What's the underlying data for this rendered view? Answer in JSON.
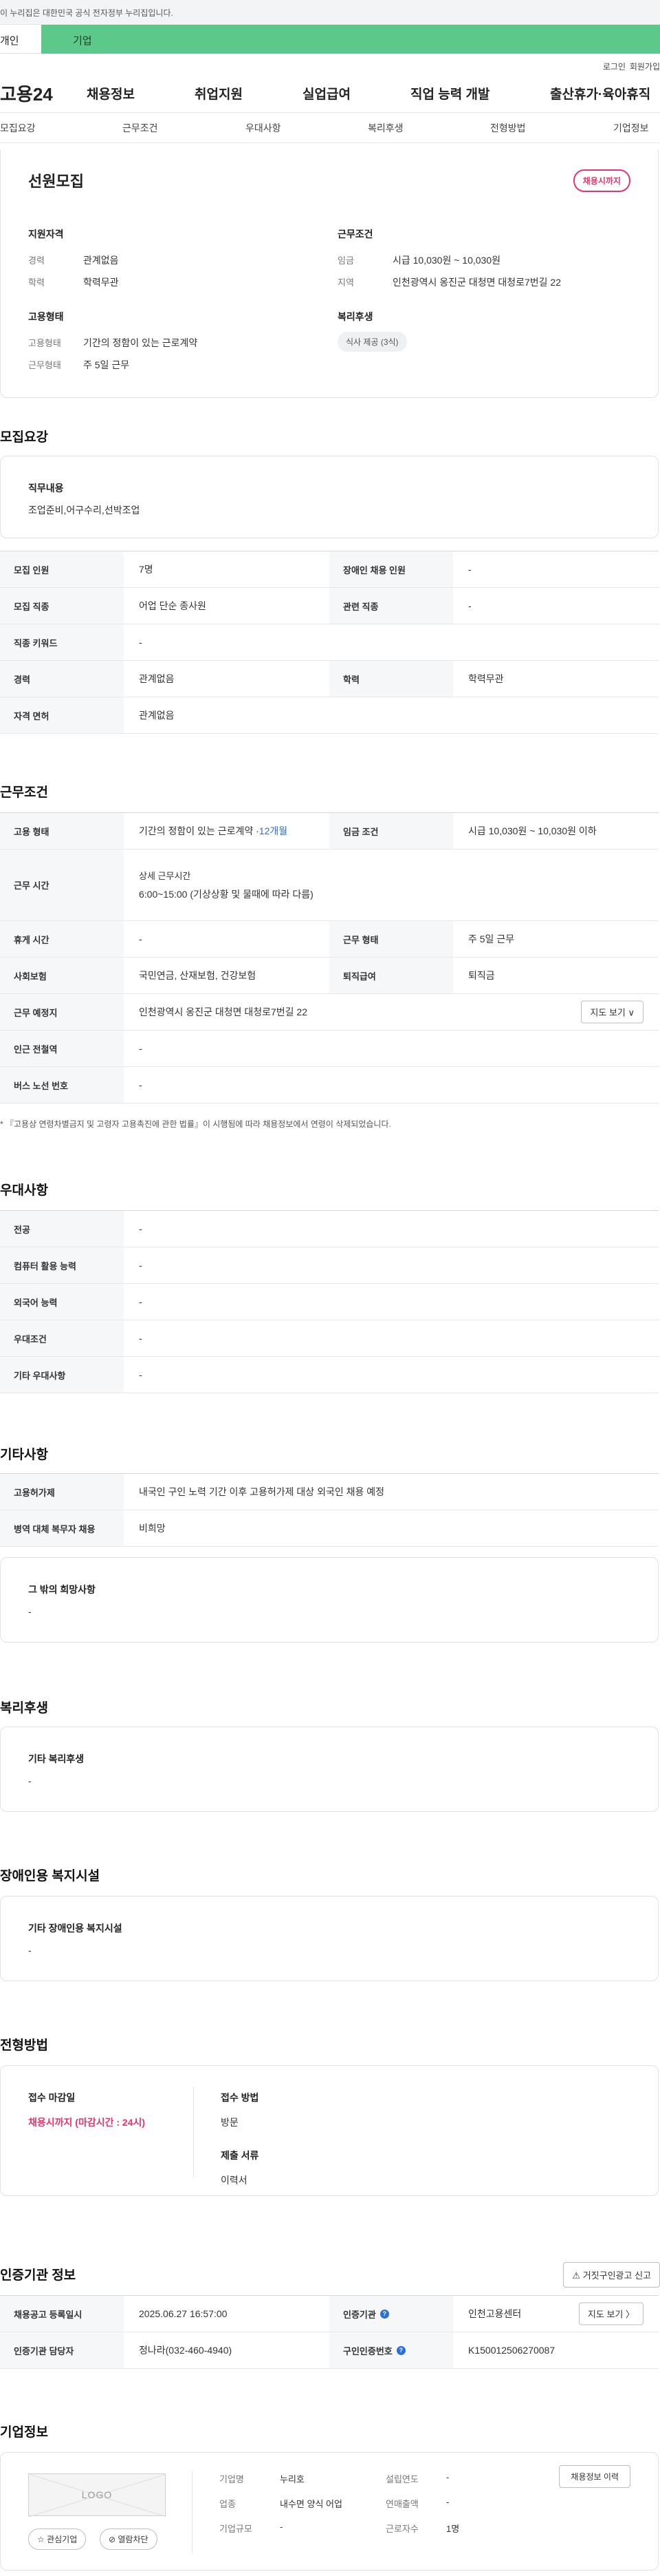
{
  "gov_banner": "이 누리집은 대한민국 공식 전자정부 누리집입니다.",
  "user_tabs": {
    "individual": "개인",
    "enterprise": "기업"
  },
  "util": {
    "login": "로그인",
    "join": "회원가입"
  },
  "gnb": {
    "logo": "고용24",
    "menus": [
      "채용정보",
      "취업지원",
      "실업급여",
      "직업 능력 개발",
      "출산휴가·육아휴직"
    ]
  },
  "subnav": [
    "모집요강",
    "근무조건",
    "우대사항",
    "복리후생",
    "전형방법",
    "기업정보"
  ],
  "job": {
    "title": "선원모집",
    "badge": "채용시까지",
    "qual_title": "지원자격",
    "qual": [
      {
        "label": "경력",
        "value": "관계없음"
      },
      {
        "label": "학력",
        "value": "학력무관"
      }
    ],
    "cond_title": "근무조건",
    "cond": [
      {
        "label": "임금",
        "value": "시급 10,030원 ~ 10,030원"
      },
      {
        "label": "지역",
        "value": "인천광역시 옹진군 대청면 대청로7번길 22"
      }
    ],
    "emp_title": "고용형태",
    "emp": [
      {
        "label": "고용형태",
        "value": "기간의 정함이 있는 근로계약"
      },
      {
        "label": "근무형태",
        "value": "주 5일 근무"
      }
    ],
    "welfare_title": "복리후생",
    "welfare_chip": "식사 제공 (3식)"
  },
  "recruit": {
    "title": "모집요강",
    "duty_label": "직무내용",
    "duty_value": "조업준비,어구수리,선박조업",
    "rows": [
      {
        "k1": "모집 인원",
        "v1": "7명",
        "k2": "장애인 채용 인원",
        "v2": "-"
      },
      {
        "k1": "모집 직종",
        "v1": "어업 단순 종사원",
        "k2": "관련 직종",
        "v2": "-"
      },
      {
        "k1": "직종 키워드",
        "v1": "-"
      },
      {
        "k1": "경력",
        "v1": "관계없음",
        "k2": "학력",
        "v2": "학력무관"
      },
      {
        "k1": "자격 면허",
        "v1": "관계없음"
      }
    ]
  },
  "work": {
    "title": "근무조건",
    "emp_type_label": "고용 형태",
    "emp_type_value": "기간의 정함이 있는 근로계약 · ",
    "emp_type_months": "12개월",
    "wage_label": "임금 조건",
    "wage_value": "시급 10,030원 ~ 10,030원 이하",
    "hours_label": "근무 시간",
    "hours_sub": "상세 근무시간",
    "hours_value": "6:00~15:00 (기상상황 및 물때에 따라 다름)",
    "rest_label": "휴게 시간",
    "rest_value": "-",
    "form_label": "근무 형태",
    "form_value": "주 5일 근무",
    "ins_label": "사회보험",
    "ins_value": "국민연금, 산재보험, 건강보험",
    "sev_label": "퇴직급여",
    "sev_value": "퇴직금",
    "place_label": "근무 예정지",
    "place_value": "인천광역시 옹진군 대청면 대청로7번길 22",
    "map_btn": "지도 보기 ∨",
    "station_label": "인근 전철역",
    "station_value": "-",
    "bus_label": "버스 노선 번호",
    "bus_value": "-",
    "note": "* 『고용상 연령차별금지 및 고령자 고용촉진에 관한 법률』이 시행됨에 따라 채용정보에서 연령이 삭제되었습니다."
  },
  "pref": {
    "title": "우대사항",
    "rows": [
      {
        "k": "전공",
        "v": "-"
      },
      {
        "k": "컴퓨터 활용 능력",
        "v": "-"
      },
      {
        "k": "외국어 능력",
        "v": "-"
      },
      {
        "k": "우대조건",
        "v": "-"
      },
      {
        "k": "기타 우대사항",
        "v": "-"
      }
    ]
  },
  "etc": {
    "title": "기타사항",
    "rows": [
      {
        "k": "고용허가제",
        "v": "내국인 구인 노력 기간 이후 고용허가제 대상 외국인 채용 예정"
      },
      {
        "k": "병역 대체 복무자 채용",
        "v": "비희망"
      }
    ],
    "other_label": "그 밖의 희망사항",
    "other_value": "-"
  },
  "welfare": {
    "title": "복리후생",
    "label": "기타 복리후생",
    "value": "-"
  },
  "disab": {
    "title": "장애인용 복지시설",
    "label": "기타 장애인용 복지시설",
    "value": "-"
  },
  "selection": {
    "title": "전형방법",
    "deadline_label": "접수 마감일",
    "deadline_value": "채용시까지 (마감시간 : 24시)",
    "method_label": "접수 방법",
    "method_value": "방문",
    "docs_label": "제출 서류",
    "docs_value": "이력서"
  },
  "cert": {
    "title": "인증기관 정보",
    "report_btn": "거짓구인광고 신고",
    "reg_label": "채용공고 등록일시",
    "reg_value": "2025.06.27 16:57:00",
    "org_label": "인증기관",
    "org_value": "인천고용센터",
    "map_btn": "지도 보기 〉",
    "mgr_label": "인증기관 담당자",
    "mgr_value": "정나라(032-460-4940)",
    "cert_label": "구인인증번호",
    "cert_value": "K150012506270087"
  },
  "company": {
    "title": "기업정보",
    "logo": "LOGO",
    "fav_btn": "관심기업",
    "block_btn": "열람차단",
    "hist_btn": "채용정보 이력",
    "rows": [
      {
        "k1": "기업명",
        "v1": "누리호",
        "k2": "설립연도",
        "v2": "-"
      },
      {
        "k1": "업종",
        "v1": "내수면 양식 어업",
        "k2": "연매출액",
        "v2": "-"
      },
      {
        "k1": "기업규모",
        "v1": "-",
        "k2": "근로자수",
        "v2": "1명"
      }
    ]
  },
  "colors": {
    "accent_green": "#5cc98a",
    "badge_pink": "#e8336b",
    "link_blue": "#2a6fdb"
  }
}
